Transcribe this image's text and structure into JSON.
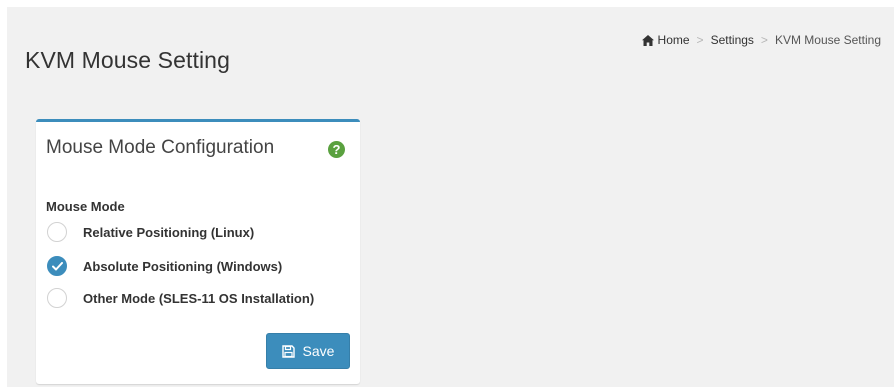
{
  "page": {
    "title": "KVM Mouse Setting"
  },
  "breadcrumb": {
    "items": [
      {
        "label": "Home",
        "icon": "home-icon"
      },
      {
        "label": "Settings"
      },
      {
        "label": "KVM Mouse Setting"
      }
    ],
    "separator": ">"
  },
  "panel": {
    "title": "Mouse Mode Configuration",
    "help_icon": "?",
    "field_label": "Mouse Mode",
    "options": [
      {
        "label": "Relative Positioning (Linux)",
        "checked": false
      },
      {
        "label": "Absolute Positioning (Windows)",
        "checked": true
      },
      {
        "label": "Other Mode (SLES-11 OS Installation)",
        "checked": false
      }
    ],
    "save_label": "Save",
    "save_icon": "floppy-disk-icon"
  },
  "colors": {
    "accent": "#3c8dbc",
    "help": "#5aa13f",
    "background": "#f1f1f1"
  }
}
